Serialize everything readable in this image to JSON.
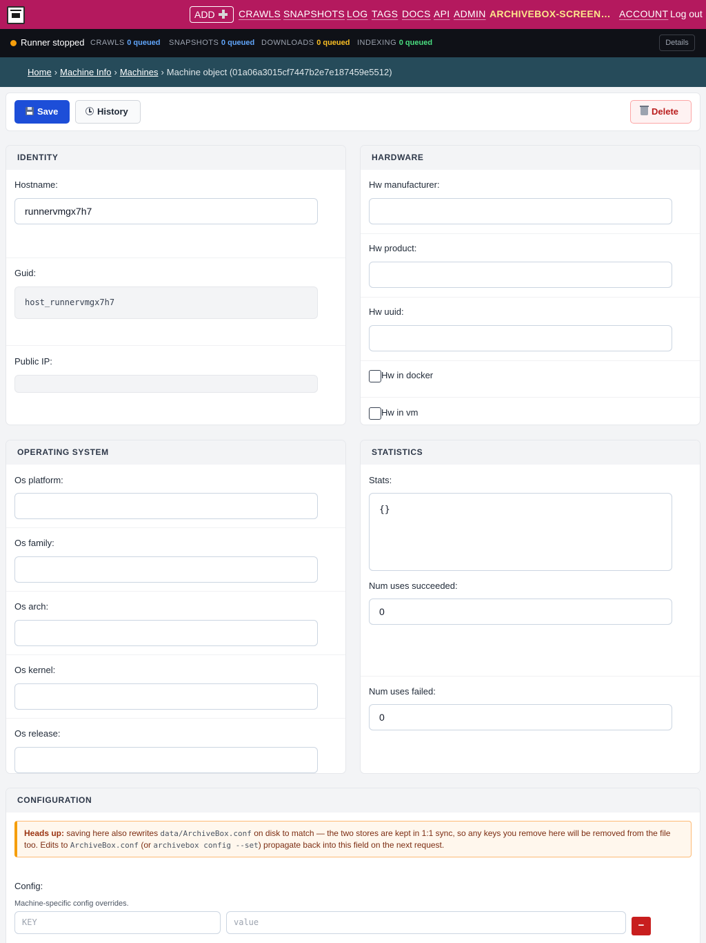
{
  "nav": {
    "add_label": "ADD",
    "links": [
      "CRAWLS",
      "SNAPSHOTS",
      "LOG",
      "TAGS",
      "DOCS",
      "API",
      "ADMIN"
    ],
    "site_name": "ARCHIVEBOX-SCREENS...",
    "account": "ACCOUNT",
    "logout": "Log out"
  },
  "status": {
    "runner": "Runner stopped",
    "runner_color": "#f59e0b",
    "queues": [
      {
        "label": "CRAWLS",
        "value": "0 queued",
        "color": "#60a5fa"
      },
      {
        "label": "SNAPSHOTS",
        "value": "0 queued",
        "color": "#60a5fa"
      },
      {
        "label": "DOWNLOADS",
        "value": "0 queued",
        "color": "#fbbf24"
      },
      {
        "label": "INDEXING",
        "value": "0 queued",
        "color": "#4ade80"
      }
    ],
    "details_label": "Details"
  },
  "breadcrumb": {
    "home": "Home",
    "machine_info": "Machine Info",
    "machines": "Machines",
    "current": "Machine object (01a06a3015cf7447b2e7e187459e5512)"
  },
  "actions": {
    "save": "Save",
    "history": "History",
    "delete": "Delete"
  },
  "identity": {
    "title": "IDENTITY",
    "hostname_label": "Hostname:",
    "hostname_value": "runnervmgx7h7",
    "guid_label": "Guid:",
    "guid_value": "host_runnervmgx7h7",
    "public_ip_label": "Public IP:"
  },
  "hardware": {
    "title": "HARDWARE",
    "manufacturer_label": "Hw manufacturer:",
    "product_label": "Hw product:",
    "uuid_label": "Hw uuid:",
    "in_docker_label": "Hw in docker",
    "in_docker": false,
    "in_vm_label": "Hw in vm",
    "in_vm": false
  },
  "os": {
    "title": "OPERATING SYSTEM",
    "platform_label": "Os platform:",
    "family_label": "Os family:",
    "arch_label": "Os arch:",
    "kernel_label": "Os kernel:",
    "release_label": "Os release:"
  },
  "statistics": {
    "title": "STATISTICS",
    "stats_label": "Stats:",
    "stats_value": "{}",
    "succeeded_label": "Num uses succeeded:",
    "succeeded_value": "0",
    "failed_label": "Num uses failed:",
    "failed_value": "0"
  },
  "configuration": {
    "title": "CONFIGURATION",
    "notice": {
      "heads_up": "Heads up:",
      "t1": " saving here also rewrites ",
      "c1": "data/ArchiveBox.conf",
      "t2": " on disk to match — the two stores are kept in 1:1 sync, so any keys you remove here will be removed from the file too. Edits to ",
      "c2": "ArchiveBox.conf",
      "t3": " (or ",
      "c3": "archivebox config --set",
      "t4": ") propagate back into this field on the next request."
    },
    "config_label": "Config:",
    "help": "Machine-specific config overrides.",
    "key_placeholder": "KEY",
    "value_placeholder": "value",
    "remove_label": "−"
  }
}
